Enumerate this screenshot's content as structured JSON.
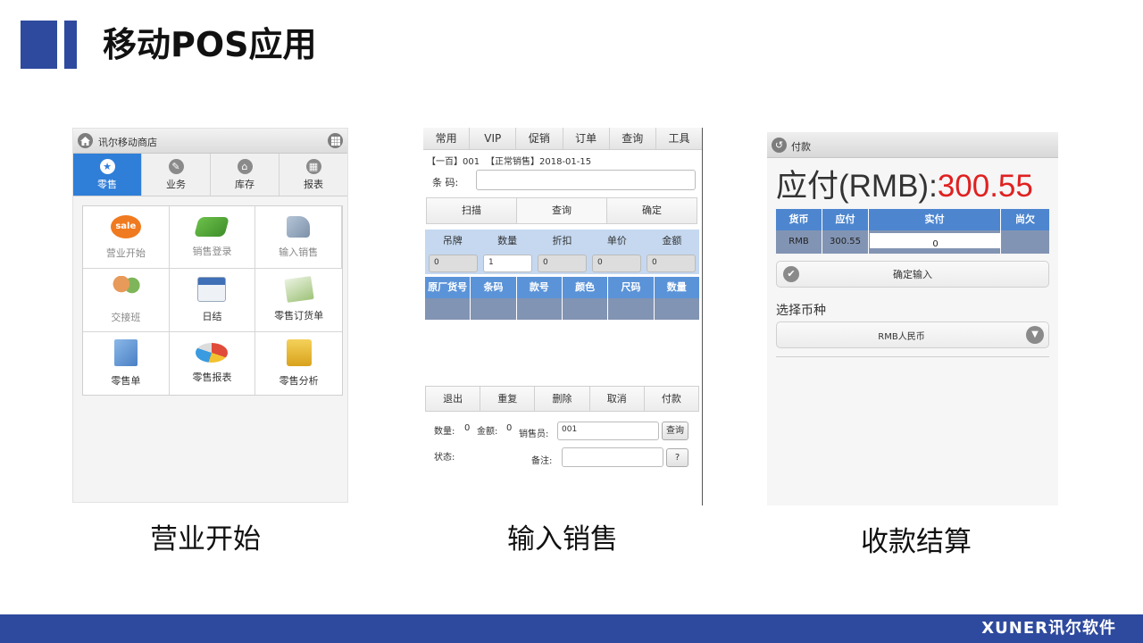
{
  "page": {
    "title": "移动POS应用",
    "brand": "XUNER讯尔软件"
  },
  "panels": [
    {
      "caption": "营业开始",
      "header_title": "讯尔移动商店",
      "tabs": [
        {
          "label": "零售",
          "icon": "star-icon",
          "active": true
        },
        {
          "label": "业务",
          "icon": "pencil-icon",
          "active": false
        },
        {
          "label": "库存",
          "icon": "home-icon",
          "active": false
        },
        {
          "label": "报表",
          "icon": "grid-icon",
          "active": false
        }
      ],
      "tiles": [
        {
          "label": "营业开始",
          "icon": "sale-icon",
          "color": "#f07a1f",
          "dim": true
        },
        {
          "label": "销售登录",
          "icon": "book-icon",
          "color": "#5fae3c",
          "dim": true
        },
        {
          "label": "输入销售",
          "icon": "scanner-icon",
          "color": "#8aa0b8",
          "dim": true
        },
        {
          "label": "交接班",
          "icon": "users-icon",
          "color": "#d8772c",
          "dim": true
        },
        {
          "label": "日结",
          "icon": "calendar-icon",
          "color": "#3f6fb6",
          "dim": false
        },
        {
          "label": "零售订货单",
          "icon": "order-icon",
          "color": "#9fc37a",
          "dim": false
        },
        {
          "label": "零售单",
          "icon": "document-icon",
          "color": "#5a8fd0",
          "dim": false
        },
        {
          "label": "零售报表",
          "icon": "pie-chart-icon",
          "color": "#e04b3a",
          "dim": false
        },
        {
          "label": "零售分析",
          "icon": "folder-lock-icon",
          "color": "#e6b62a",
          "dim": false
        }
      ]
    },
    {
      "caption": "输入销售",
      "menu": [
        "常用",
        "VIP",
        "促销",
        "订单",
        "查询",
        "工具"
      ],
      "info_store": "【一百】001",
      "info_type": "【正常销售】2018-01-15",
      "barcode_label": "条  码:",
      "barcode_value": "",
      "actions": [
        "扫描",
        "查询",
        "确定"
      ],
      "fields_head": [
        "吊牌",
        "数量",
        "折扣",
        "单价",
        "金额"
      ],
      "fields_vals": [
        "0",
        "1",
        "0",
        "0",
        "0"
      ],
      "table_head": [
        "原厂货号",
        "条码",
        "款号",
        "颜色",
        "尺码",
        "数量"
      ],
      "bottom_actions": [
        "退出",
        "重复",
        "删除",
        "取消",
        "付款"
      ],
      "qty_label": "数量:",
      "qty_value": "0",
      "amount_label": "金额:",
      "amount_value": "0",
      "clerk_label": "销售员:",
      "clerk_value": "001",
      "clerk_btn": "查询",
      "status_label": "状态:",
      "remark_label": "备注:",
      "remark_btn": "?"
    },
    {
      "caption": "收款结算",
      "header_title": "付款",
      "due_label": "应付(RMB):",
      "due_value": "300.55",
      "due_color": "#e02020",
      "table_head": [
        "货币",
        "应付",
        "实付",
        "尚欠"
      ],
      "row": {
        "currency": "RMB",
        "due": "300.55",
        "paid": "0",
        "owed": ""
      },
      "confirm_label": "确定输入",
      "currency_section": "选择币种",
      "currency_selected": "RMB人民币"
    }
  ]
}
